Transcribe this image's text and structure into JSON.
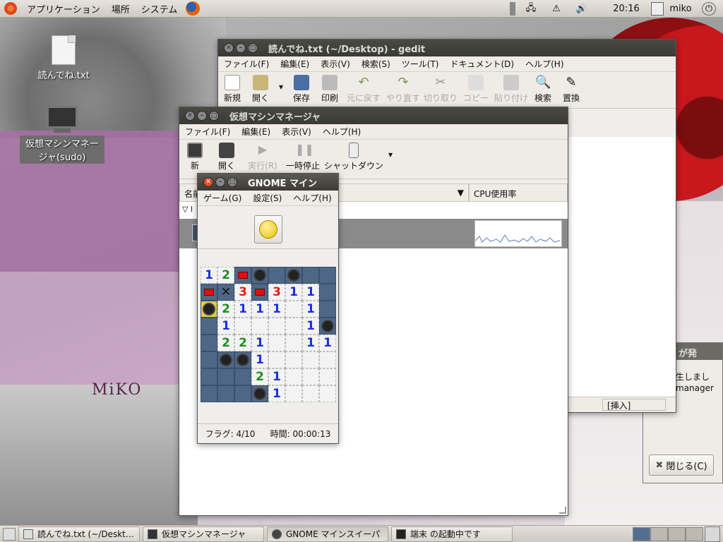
{
  "top_panel": {
    "menu_apps": "アプリケーション",
    "menu_places": "場所",
    "menu_system": "システム",
    "clock": "20:16",
    "user": "miko"
  },
  "desktop": {
    "icon_file": "読んでね.txt",
    "icon_vm_line1": "仮想マシンマネー",
    "icon_vm_line2": "ジャ(sudo)",
    "logo": "MiKO"
  },
  "gedit": {
    "title": "読んでね.txt (~/Desktop) - gedit",
    "menus": [
      "ファイル(F)",
      "編集(E)",
      "表示(V)",
      "検索(S)",
      "ツール(T)",
      "ドキュメント(D)",
      "ヘルプ(H)"
    ],
    "toolbar": [
      "新規",
      "開く",
      "保存",
      "印刷",
      "元に戻す",
      "やり直す",
      "切り取り",
      "コピー",
      "貼り付け",
      "検索",
      "置換"
    ],
    "status_insert": "[挿入]"
  },
  "dialog": {
    "title_fragment": "が発",
    "msg_line1": "生しまし",
    "msg_line2": "manager",
    "close_label": "閉じる(C)"
  },
  "virt": {
    "title": "仮想マシンマネージャ",
    "menus": [
      "ファイル(F)",
      "編集(E)",
      "表示(V)",
      "ヘルプ(H)"
    ],
    "toolbar": [
      "新",
      "開く",
      "実行(R)",
      "一時停止",
      "シャットダウン"
    ],
    "col_name": "名前",
    "col_cpu": "CPU使用率",
    "tree_label": "l"
  },
  "mines": {
    "title": "GNOME マイン",
    "menus": [
      "ゲーム(G)",
      "設定(S)",
      "ヘルプ(H)"
    ],
    "flags": "フラグ: 4/10",
    "time": "時間: 00:00:13",
    "board": [
      [
        "1",
        "2",
        "F",
        "M",
        "C",
        "M",
        "C",
        "C"
      ],
      [
        "F",
        "X",
        "3",
        "F",
        "3",
        "1",
        "1",
        "C"
      ],
      [
        "B",
        "2",
        "1",
        "1",
        "1",
        "",
        "1",
        "C"
      ],
      [
        "C",
        "1",
        "",
        "",
        "",
        "",
        "1",
        "M"
      ],
      [
        "C",
        "2",
        "2",
        "1",
        "",
        "",
        "1",
        "1"
      ],
      [
        "C",
        "M",
        "M",
        "1",
        "",
        "",
        "",
        ""
      ],
      [
        "C",
        "C",
        "C",
        "2",
        "1",
        "",
        "",
        ""
      ],
      [
        "C",
        "C",
        "C",
        "M",
        "1",
        "",
        "",
        ""
      ]
    ]
  },
  "taskbar": {
    "tasks": [
      "読んでね.txt (~/Deskt…",
      "仮想マシンマネージャ",
      "GNOME マインスイーパ",
      "端末 の起動中です"
    ]
  },
  "colors": {
    "accent_close": "#e0502a",
    "cell_covered": "#4f6787",
    "num1": "#1a2ee0",
    "num2": "#1e8f1e",
    "num3": "#e01c1c"
  }
}
